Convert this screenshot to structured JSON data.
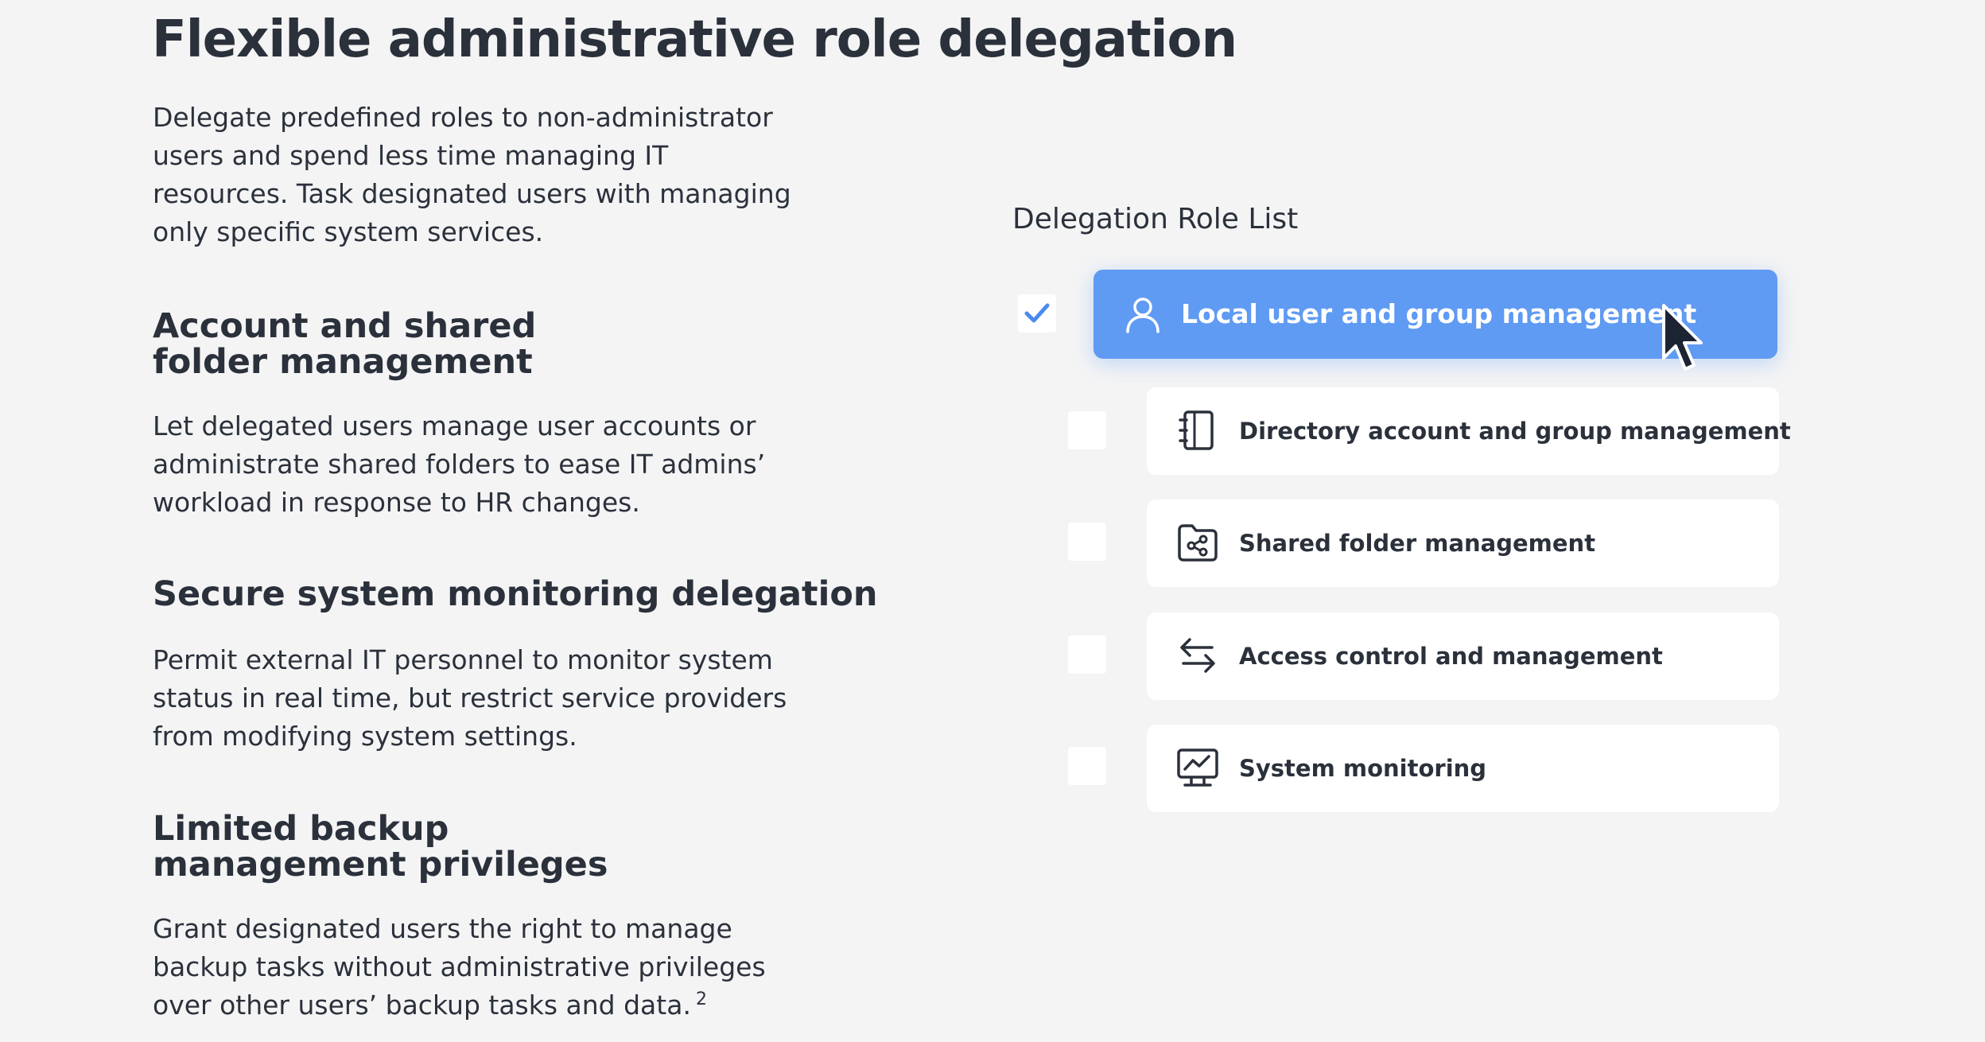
{
  "page": {
    "title": "Flexible administrative role delegation",
    "intro": "Delegate predefined roles to non-administrator users and spend less time managing IT resources. Task designated users with managing only specific system services."
  },
  "sections": [
    {
      "heading": "Account and shared folder management",
      "body": "Let delegated users manage user accounts or administrate shared folders to ease IT admins’ workload in response to HR changes."
    },
    {
      "heading": "Secure system monitoring delegation",
      "body": "Permit external IT personnel to monitor system status in real time, but restrict service providers from modifying system settings."
    },
    {
      "heading": "Limited backup management privileges",
      "body": "Grant designated users the right to manage backup tasks without administrative privileges over other users’ backup tasks and data.",
      "footnote": "2"
    }
  ],
  "role_list": {
    "title": "Delegation Role List",
    "accent_color": "#5f9af3",
    "items": [
      {
        "label": "Local user and group management",
        "icon": "user-icon",
        "checked": true,
        "active": true
      },
      {
        "label": "Directory account and group management",
        "icon": "address-book-icon",
        "checked": false,
        "active": false
      },
      {
        "label": "Shared folder management",
        "icon": "shared-folder-icon",
        "checked": false,
        "active": false
      },
      {
        "label": "Access control and management",
        "icon": "transfer-arrows-icon",
        "checked": false,
        "active": false
      },
      {
        "label": "System monitoring",
        "icon": "monitor-chart-icon",
        "checked": false,
        "active": false
      }
    ]
  }
}
